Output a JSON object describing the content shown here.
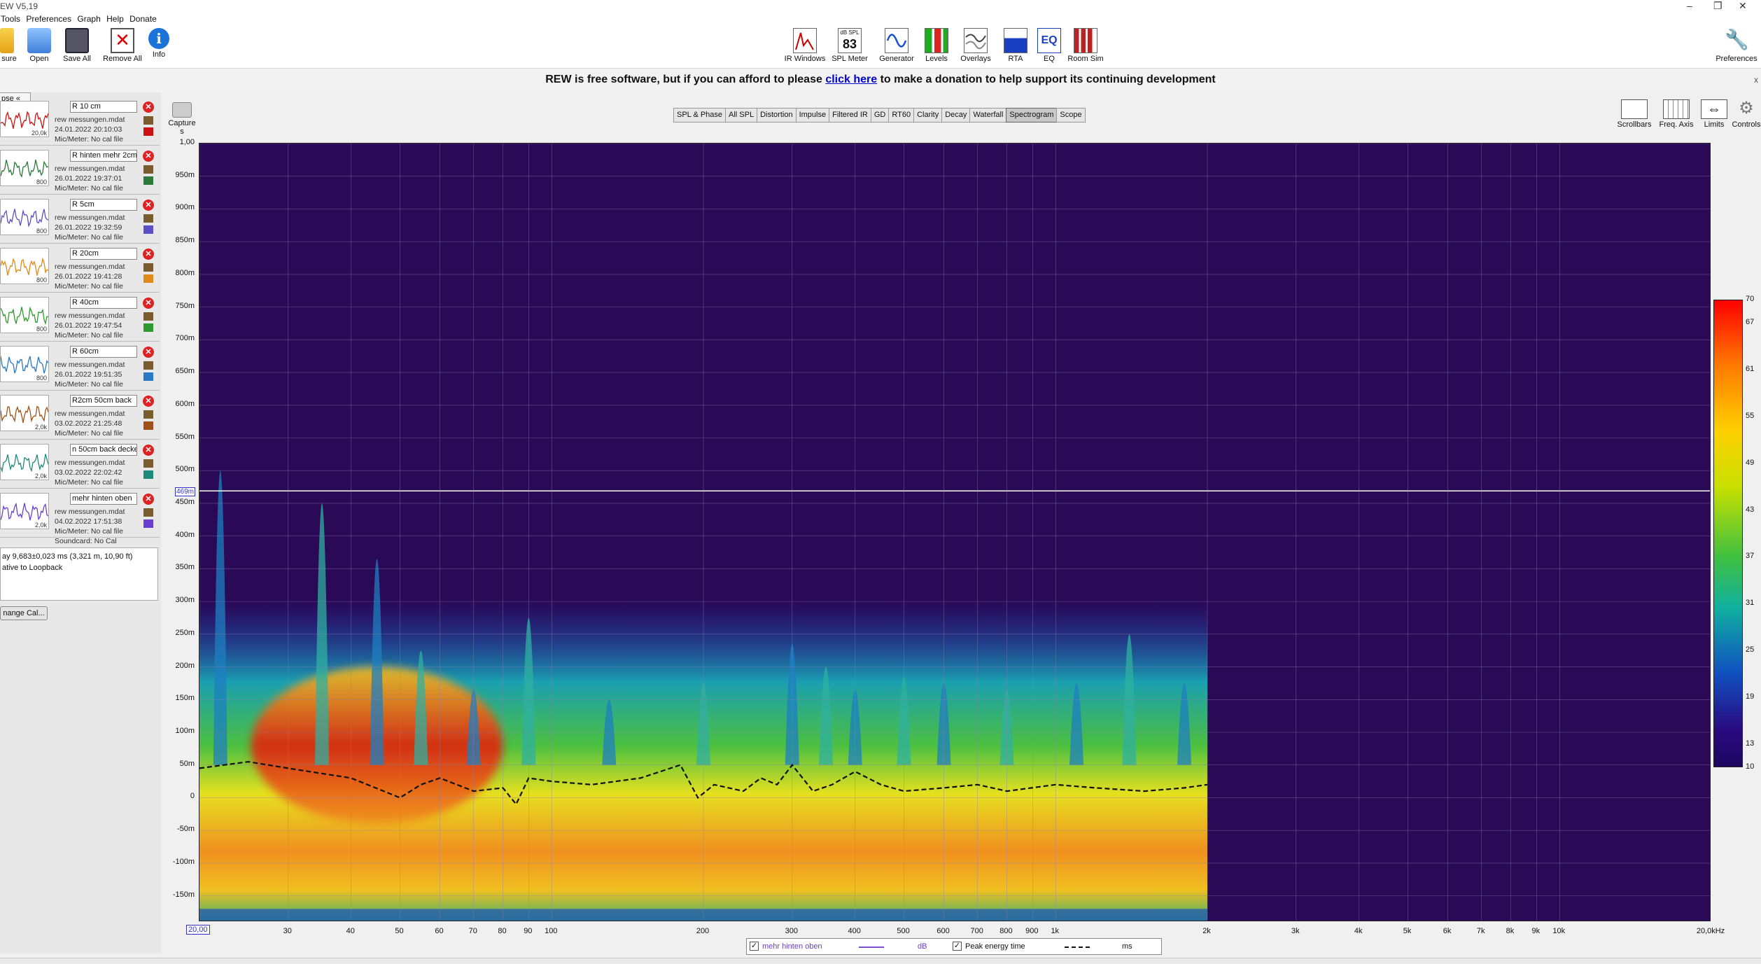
{
  "window": {
    "title": "EW V5,19",
    "controls": [
      "–",
      "❐",
      "✕"
    ]
  },
  "menu": [
    "Tools",
    "Preferences",
    "Graph",
    "Help",
    "Donate"
  ],
  "toolbar": {
    "left": [
      {
        "label": "sure",
        "icon": "measure-icon"
      },
      {
        "label": "Open",
        "icon": "folder-open-icon"
      },
      {
        "label": "Save All",
        "icon": "save-all-icon"
      },
      {
        "label": "Remove All",
        "icon": "remove-all-icon"
      },
      {
        "label": "Info",
        "icon": "info-icon"
      }
    ],
    "center": [
      {
        "label": "IR Windows",
        "icon": "ir-windows-icon"
      },
      {
        "label": "SPL Meter",
        "icon": "spl-meter-icon",
        "readout_top": "dB SPL",
        "readout_value": "83"
      },
      {
        "label": "Generator",
        "icon": "generator-icon"
      },
      {
        "label": "Levels",
        "icon": "levels-icon"
      },
      {
        "label": "Overlays",
        "icon": "overlays-icon"
      },
      {
        "label": "RTA",
        "icon": "rta-icon"
      },
      {
        "label": "EQ",
        "icon": "eq-icon"
      },
      {
        "label": "Room Sim",
        "icon": "room-sim-icon"
      }
    ],
    "right": {
      "label": "Preferences",
      "icon": "wrench-icon"
    }
  },
  "banner": {
    "before": "REW is free software, but if you can afford to please ",
    "link": "click here",
    "after": " to make a donation to help support its continuing development",
    "close": "x"
  },
  "left_panel": {
    "collapse_label": "pse",
    "collapse_icon": "«",
    "measurements": [
      {
        "name": "R 10 cm",
        "file": "rew messungen.mdat",
        "date": "24.01.2022 20:10:03",
        "mic": "Mic/Meter: No cal file",
        "extra": "",
        "color": "#cc1111",
        "thumb_label": "20,0k"
      },
      {
        "name": "R hinten mehr 2cm",
        "file": "rew messungen.mdat",
        "date": "26.01.2022 19:37:01",
        "mic": "Mic/Meter: No cal file",
        "extra": "",
        "color": "#2b7a3a",
        "thumb_label": "800"
      },
      {
        "name": "R 5cm",
        "file": "rew messungen.mdat",
        "date": "26.01.2022 19:32:59",
        "mic": "Mic/Meter: No cal file",
        "extra": "",
        "color": "#5b4fc9",
        "thumb_label": "800"
      },
      {
        "name": "R 20cm",
        "file": "rew messungen.mdat",
        "date": "26.01.2022 19:41:28",
        "mic": "Mic/Meter: No cal file",
        "extra": "",
        "color": "#e08a1a",
        "thumb_label": "800"
      },
      {
        "name": "R 40cm",
        "file": "rew messungen.mdat",
        "date": "26.01.2022 19:47:54",
        "mic": "Mic/Meter: No cal file",
        "extra": "",
        "color": "#2f9a2f",
        "thumb_label": "800"
      },
      {
        "name": "R 60cm",
        "file": "rew messungen.mdat",
        "date": "26.01.2022 19:51:35",
        "mic": "Mic/Meter: No cal file",
        "extra": "",
        "color": "#2a78c8",
        "thumb_label": "800"
      },
      {
        "name": "R2cm 50cm back",
        "file": "rew messungen.mdat",
        "date": "03.02.2022 21:25:48",
        "mic": "Mic/Meter: No cal file",
        "extra": "",
        "color": "#a0521a",
        "thumb_label": "2,0k"
      },
      {
        "name": "n 50cm back decke",
        "file": "rew messungen.mdat",
        "date": "03.02.2022 22:02:42",
        "mic": "Mic/Meter: No cal file",
        "extra": "",
        "color": "#1f8a7a",
        "thumb_label": "2,0k"
      },
      {
        "name": "mehr hinten oben",
        "file": "rew messungen.mdat",
        "date": "04.02.2022 17:51:38",
        "mic": "Mic/Meter: No cal file",
        "extra": "Soundcard: No Cal",
        "color": "#6a3fd0",
        "thumb_label": "2,0k"
      }
    ],
    "info_line1": "ay 9,683±0,023 ms (3,321 m, 10,90 ft)",
    "info_line2": "ative to Loopback",
    "change_cal": "nange Cal..."
  },
  "graph": {
    "capture_label": "Capture",
    "capture_unit": "s",
    "tabs": [
      "SPL & Phase",
      "All SPL",
      "Distortion",
      "Impulse",
      "Filtered IR",
      "GD",
      "RT60",
      "Clarity",
      "Decay",
      "Waterfall",
      "Spectrogram",
      "Scope"
    ],
    "active_tab": "Spectrogram",
    "right_tools": [
      {
        "label": "Scrollbars",
        "icon": "scrollbars-icon"
      },
      {
        "label": "Freq. Axis",
        "icon": "freq-axis-icon"
      },
      {
        "label": "Limits",
        "icon": "limits-icon"
      },
      {
        "label": "Controls",
        "icon": "gear-icon"
      }
    ],
    "cursor_y": "469m",
    "cursor_x": "20,00",
    "legend": {
      "series_name": "mehr hinten oben",
      "series_unit": "dB",
      "second_name": "Peak energy time",
      "second_unit": "ms"
    }
  },
  "chart_data": {
    "type": "heatmap",
    "title": "",
    "x_scale": "log",
    "xlim": [
      20,
      20000
    ],
    "x_ticks": [
      "20,00",
      "30",
      "40",
      "50",
      "60",
      "70",
      "80",
      "90",
      "100",
      "200",
      "300",
      "400",
      "500",
      "600",
      "700",
      "800",
      "900",
      "1k",
      "2k",
      "3k",
      "4k",
      "5k",
      "6k",
      "7k",
      "8k",
      "9k",
      "10k",
      "20,0kHz"
    ],
    "x_tick_values": [
      20,
      30,
      40,
      50,
      60,
      70,
      80,
      90,
      100,
      200,
      300,
      400,
      500,
      600,
      700,
      800,
      900,
      1000,
      2000,
      3000,
      4000,
      5000,
      6000,
      7000,
      8000,
      9000,
      10000,
      20000
    ],
    "ylim": [
      -0.19,
      1.0
    ],
    "y_ticks": [
      "1,00",
      "950m",
      "900m",
      "850m",
      "800m",
      "750m",
      "700m",
      "650m",
      "600m",
      "550m",
      "500m",
      "450m",
      "400m",
      "350m",
      "300m",
      "250m",
      "200m",
      "150m",
      "100m",
      "50m",
      "0",
      "-50m",
      "-100m",
      "-150m"
    ],
    "y_tick_values": [
      1.0,
      0.95,
      0.9,
      0.85,
      0.8,
      0.75,
      0.7,
      0.65,
      0.6,
      0.55,
      0.5,
      0.45,
      0.4,
      0.35,
      0.3,
      0.25,
      0.2,
      0.15,
      0.1,
      0.05,
      0,
      -0.05,
      -0.1,
      -0.15
    ],
    "color_scale_ticks": [
      "70",
      "67",
      "61",
      "55",
      "49",
      "43",
      "37",
      "31",
      "25",
      "19",
      "13",
      "10"
    ],
    "color_scale_values": [
      70,
      67,
      61,
      55,
      49,
      43,
      37,
      31,
      25,
      19,
      13,
      10
    ],
    "data_upper_freq": 2000,
    "cursor_time": 0.469,
    "peak_energy_time": {
      "x": [
        20,
        25,
        30,
        40,
        50,
        55,
        60,
        70,
        80,
        85,
        90,
        100,
        120,
        150,
        180,
        195,
        210,
        240,
        260,
        280,
        300,
        330,
        360,
        400,
        450,
        500,
        600,
        700,
        800,
        1000,
        1200,
        1500,
        1800,
        2000
      ],
      "y": [
        0.045,
        0.055,
        0.045,
        0.03,
        0.0,
        0.02,
        0.03,
        0.01,
        0.015,
        -0.01,
        0.03,
        0.025,
        0.02,
        0.03,
        0.05,
        0.0,
        0.02,
        0.01,
        0.03,
        0.02,
        0.05,
        0.01,
        0.02,
        0.04,
        0.02,
        0.01,
        0.015,
        0.02,
        0.01,
        0.02,
        0.015,
        0.01,
        0.015,
        0.02
      ]
    }
  }
}
